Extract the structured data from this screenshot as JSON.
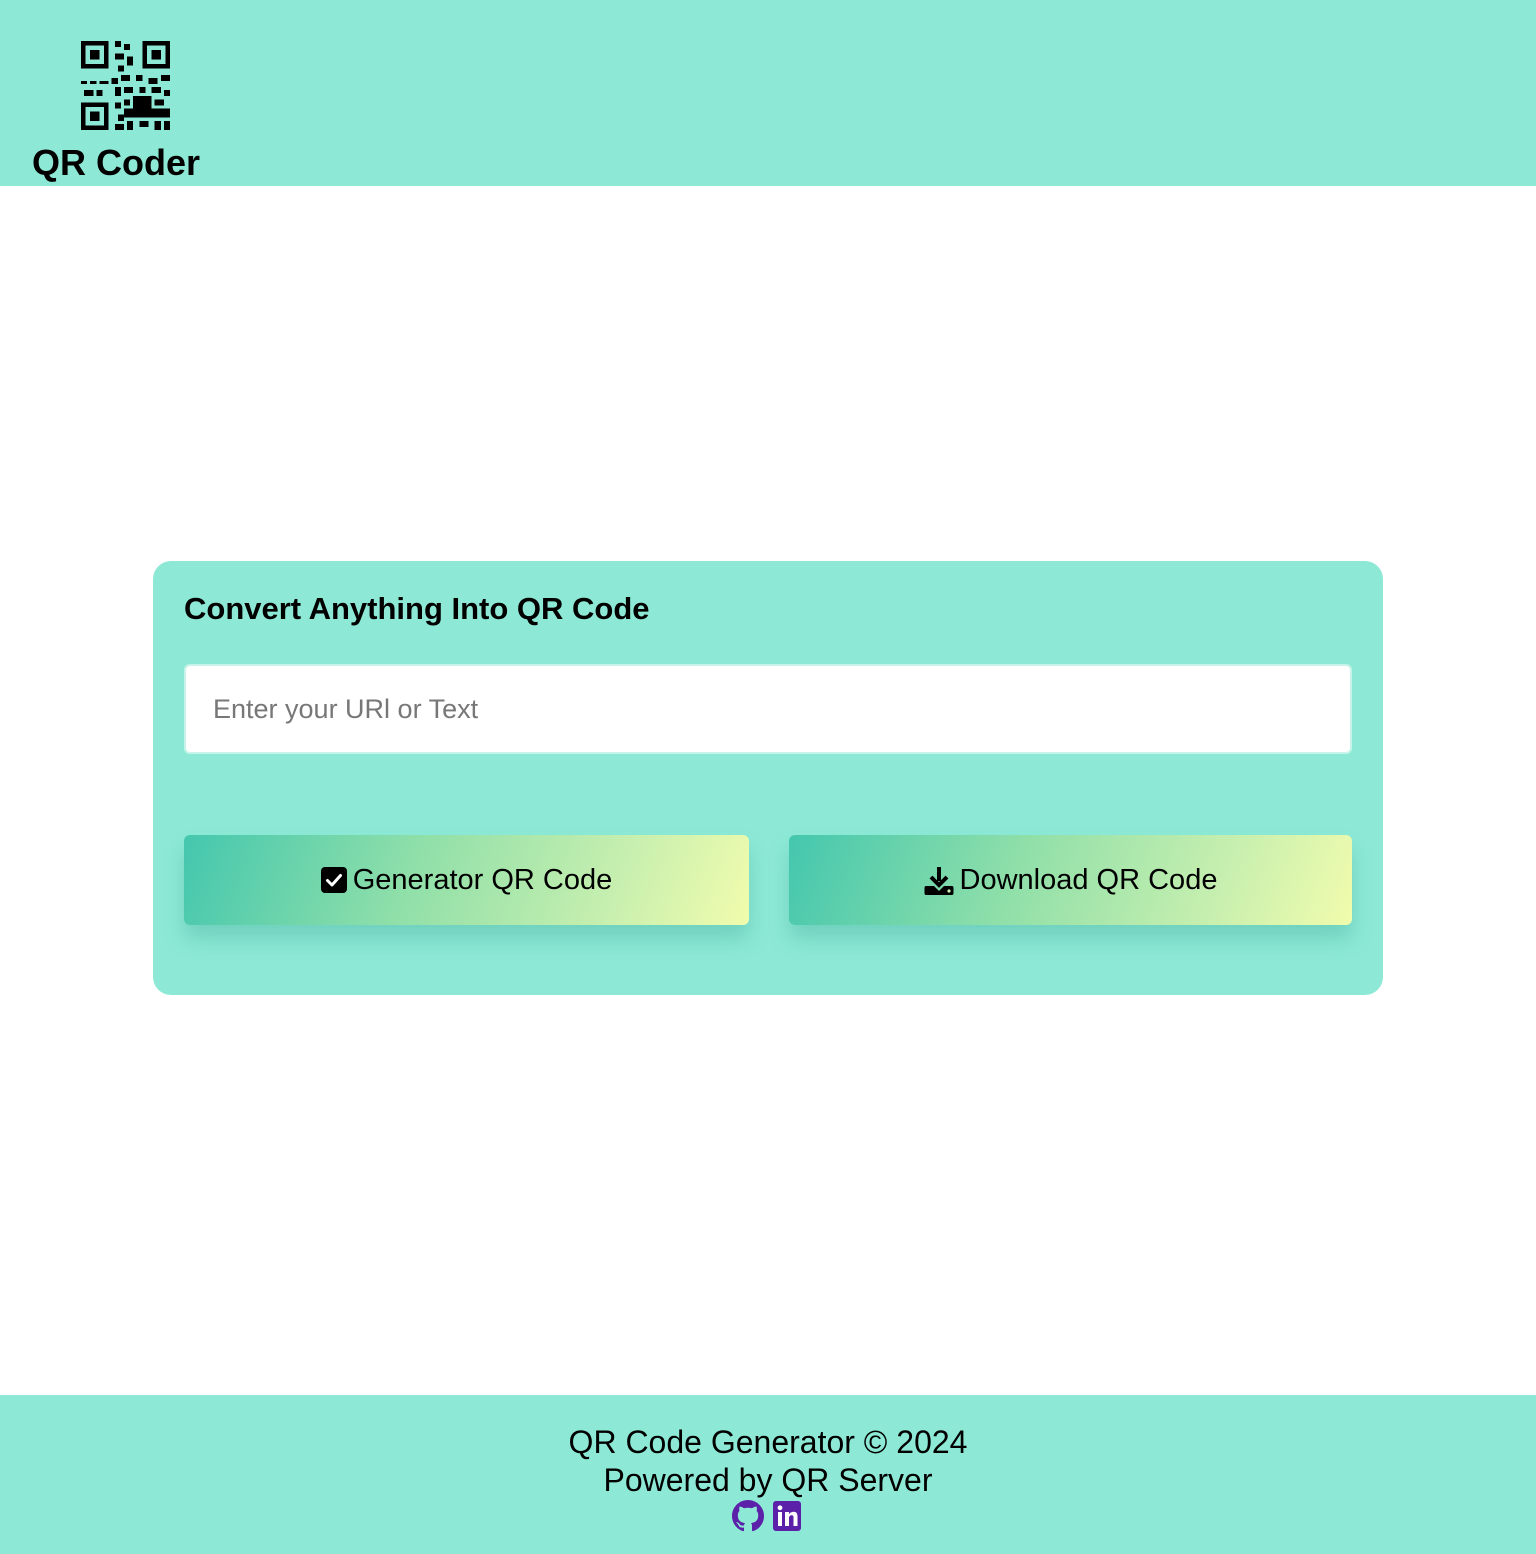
{
  "header": {
    "brand": "QR Coder",
    "logo_icon": "qr-code-icon"
  },
  "card": {
    "title": "Convert Anything Into QR Code",
    "input": {
      "placeholder": "Enter your URl or Text",
      "value": ""
    },
    "generate_button": {
      "label": "Generator QR Code",
      "icon": "check-square-icon"
    },
    "download_button": {
      "label": "Download QR Code",
      "icon": "download-icon"
    }
  },
  "footer": {
    "line1": "QR Code Generator © 2024",
    "line2": "Powered by QR Server",
    "social": [
      {
        "name": "github-icon"
      },
      {
        "name": "linkedin-icon"
      }
    ]
  },
  "colors": {
    "background_panel": "#8de9d6",
    "button_gradient_start": "#44c7ae",
    "button_gradient_end": "#f1fcad",
    "social_icon": "#5b21a8"
  }
}
